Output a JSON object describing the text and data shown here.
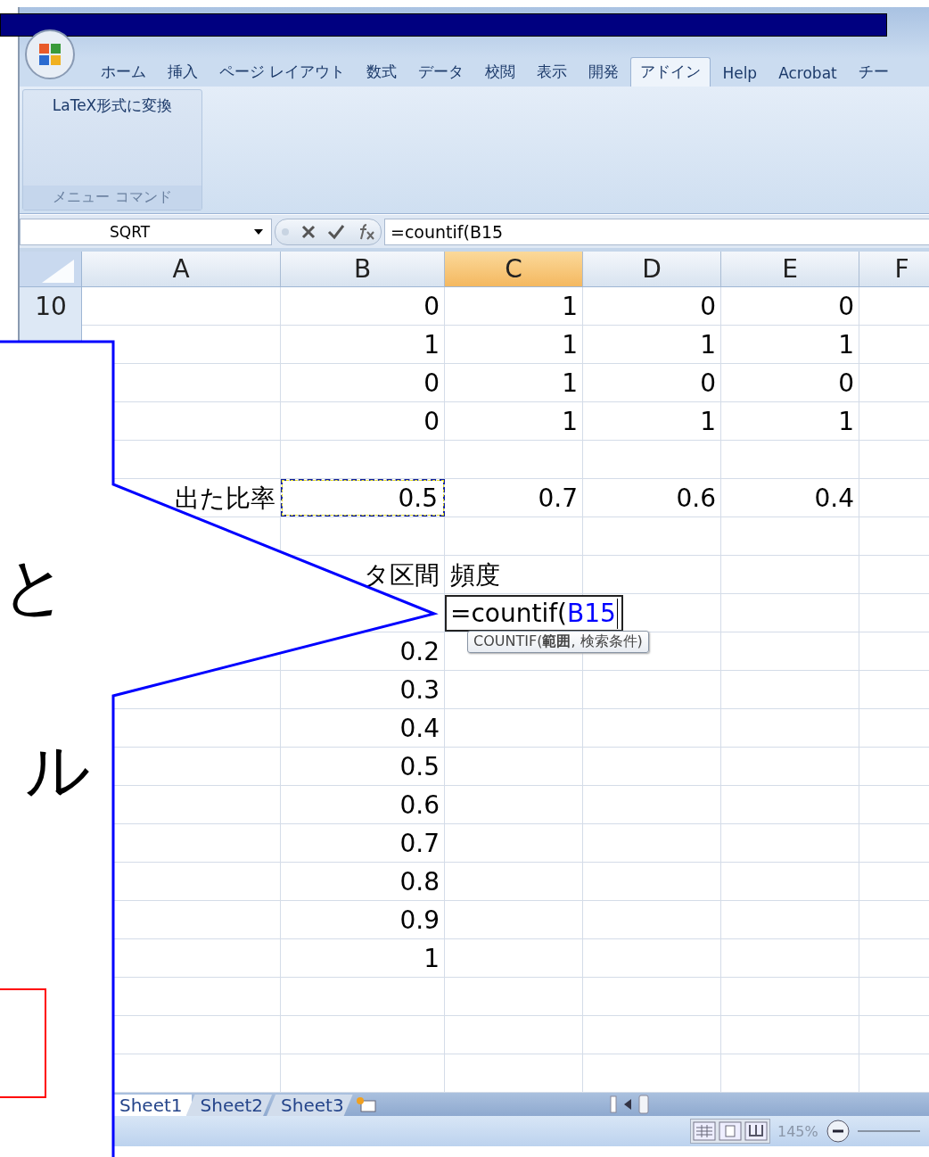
{
  "ribbon": {
    "tabs": [
      {
        "label": "ホーム",
        "selected": false
      },
      {
        "label": "挿入",
        "selected": false
      },
      {
        "label": "ページ レイアウト",
        "selected": false
      },
      {
        "label": "数式",
        "selected": false
      },
      {
        "label": "データ",
        "selected": false
      },
      {
        "label": "校閲",
        "selected": false
      },
      {
        "label": "表示",
        "selected": false
      },
      {
        "label": "開発",
        "selected": false
      },
      {
        "label": "アドイン",
        "selected": true
      },
      {
        "label": "Help",
        "selected": false
      },
      {
        "label": "Acrobat",
        "selected": false
      },
      {
        "label": "チー",
        "selected": false
      }
    ],
    "groups": [
      {
        "button": "LaTeX形式に変換",
        "label": "メニュー コマンド"
      }
    ]
  },
  "formula_bar": {
    "name_box": "SQRT",
    "formula": "=countif(B15"
  },
  "sheet": {
    "columns": [
      {
        "label": "A",
        "selected": false
      },
      {
        "label": "B",
        "selected": false
      },
      {
        "label": "C",
        "selected": true
      },
      {
        "label": "D",
        "selected": false
      },
      {
        "label": "E",
        "selected": false
      },
      {
        "label": "F",
        "selected": false
      }
    ],
    "rows": [
      {
        "header": "10",
        "kind": "values",
        "b": {
          "kind": "number",
          "text": "0"
        },
        "c": {
          "kind": "number",
          "text": "1"
        },
        "d": {
          "kind": "number",
          "text": "0"
        },
        "e": {
          "kind": "number",
          "text": "0"
        }
      },
      {
        "kind": "values",
        "b": {
          "kind": "number",
          "text": "1"
        },
        "c": {
          "kind": "number",
          "text": "1"
        },
        "d": {
          "kind": "number",
          "text": "1"
        },
        "e": {
          "kind": "number",
          "text": "1"
        }
      },
      {
        "kind": "values",
        "b": {
          "kind": "number",
          "text": "0"
        },
        "c": {
          "kind": "number",
          "text": "1"
        },
        "d": {
          "kind": "number",
          "text": "0"
        },
        "e": {
          "kind": "number",
          "text": "0"
        }
      },
      {
        "kind": "values",
        "b": {
          "kind": "number",
          "text": "0"
        },
        "c": {
          "kind": "number",
          "text": "1"
        },
        "d": {
          "kind": "number",
          "text": "1"
        },
        "e": {
          "kind": "number",
          "text": "1"
        }
      },
      {
        "kind": "blank"
      },
      {
        "kind": "values",
        "a": {
          "kind": "label",
          "text": "出た比率"
        },
        "b": {
          "kind": "number",
          "text": "0.5",
          "copy_source": true
        },
        "c": {
          "kind": "number",
          "text": "0.7"
        },
        "d": {
          "kind": "number",
          "text": "0.6"
        },
        "e": {
          "kind": "number",
          "text": "0.4"
        }
      },
      {
        "kind": "blank"
      },
      {
        "kind": "values",
        "b": {
          "kind": "label",
          "text": "タ区間"
        },
        "c": {
          "kind": "text",
          "text": "頻度"
        }
      },
      {
        "kind": "values",
        "c": {
          "kind": "editing",
          "text": "=countif(",
          "reference": "B15",
          "tooltip": "COUNTIF(**範囲**, 検索条件)"
        }
      },
      {
        "kind": "values",
        "b": {
          "kind": "number",
          "text": "0.2"
        }
      },
      {
        "kind": "values",
        "b": {
          "kind": "number",
          "text": "0.3"
        }
      },
      {
        "kind": "values",
        "b": {
          "kind": "number",
          "text": "0.4"
        }
      },
      {
        "kind": "values",
        "b": {
          "kind": "number",
          "text": "0.5"
        }
      },
      {
        "kind": "values",
        "b": {
          "kind": "number",
          "text": "0.6"
        }
      },
      {
        "kind": "values",
        "b": {
          "kind": "number",
          "text": "0.7"
        }
      },
      {
        "kind": "values",
        "b": {
          "kind": "number",
          "text": "0.8"
        }
      },
      {
        "kind": "values",
        "b": {
          "kind": "number",
          "text": "0.9"
        }
      },
      {
        "kind": "values",
        "b": {
          "kind": "number",
          "text": "1"
        }
      },
      {
        "kind": "blank"
      },
      {
        "kind": "blank"
      },
      {
        "kind": "blank"
      }
    ]
  },
  "sheet_tabs": [
    {
      "label": "Sheet1",
      "selected": true
    },
    {
      "label": "Sheet2",
      "selected": false
    },
    {
      "label": "Sheet3",
      "selected": false
    }
  ],
  "status_bar": {
    "zoom": "145%"
  },
  "callout": {
    "texts": [
      "と",
      "ル"
    ]
  }
}
